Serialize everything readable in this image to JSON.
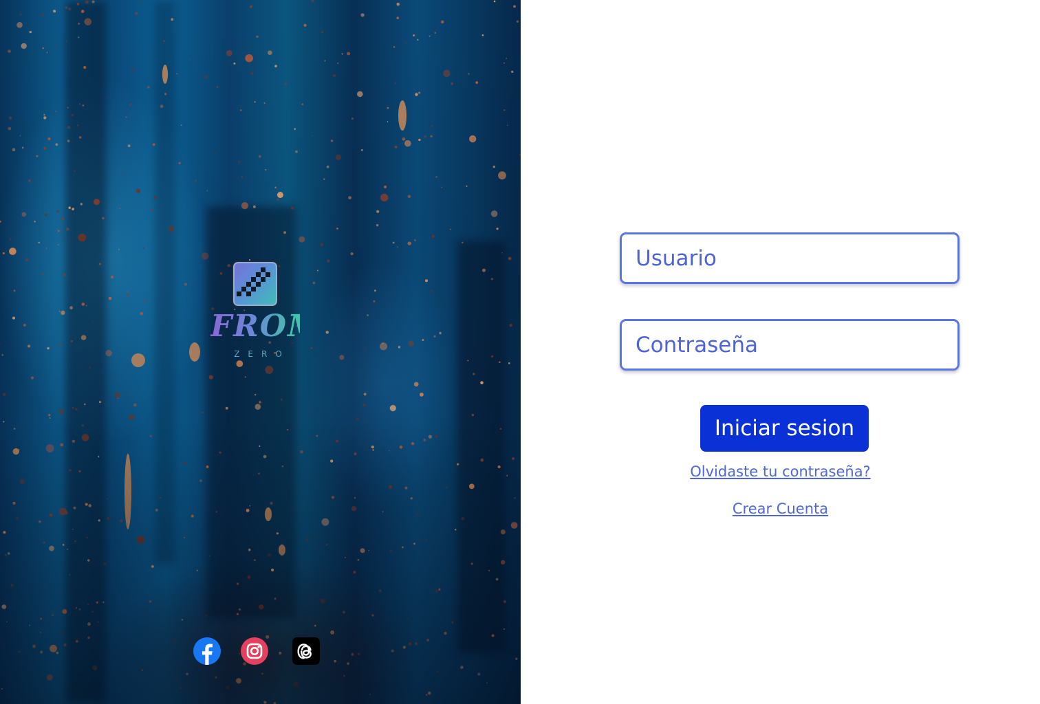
{
  "brand": {
    "logo_word": "FROM",
    "logo_sub": "ZERO",
    "icon": "checkered-square-logo-icon"
  },
  "social": [
    {
      "name": "facebook",
      "icon": "facebook-icon",
      "color": "#1877f2"
    },
    {
      "name": "instagram",
      "icon": "instagram-icon",
      "color": "#e4405f"
    },
    {
      "name": "threads",
      "icon": "threads-icon",
      "color": "#000000"
    }
  ],
  "login": {
    "username_placeholder": "Usuario",
    "password_placeholder": "Contraseña",
    "submit_label": "Iniciar sesion",
    "forgot_label": "Olvidaste tu contraseña?",
    "create_label": "Crear Cuenta"
  },
  "colors": {
    "accent": "#0a31d6",
    "field_border": "#5a75e6",
    "link": "#4e66d8"
  }
}
